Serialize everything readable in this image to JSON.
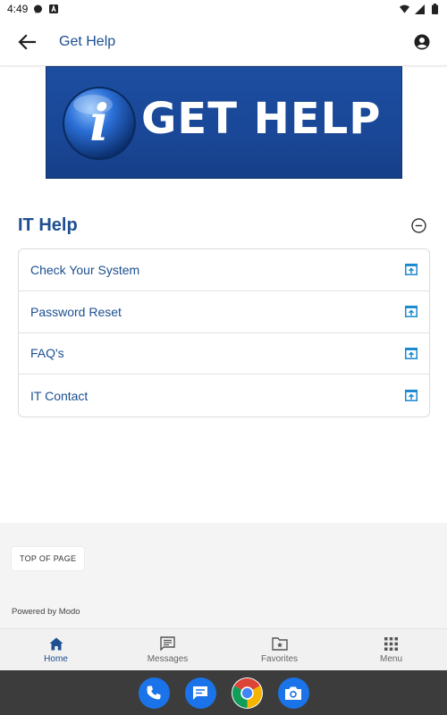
{
  "status_bar": {
    "time": "4:49"
  },
  "header": {
    "title": "Get Help",
    "back_icon": "arrow-left-icon",
    "account_icon": "account-circle-icon"
  },
  "banner": {
    "text": "GET HELP",
    "logo_letter": "i"
  },
  "section": {
    "title": "IT Help",
    "collapse_icon": "minus-circle-icon",
    "items": [
      {
        "label": "Check Your System",
        "icon": "open-external-icon"
      },
      {
        "label": "Password Reset",
        "icon": "open-external-icon"
      },
      {
        "label": "FAQ's",
        "icon": "open-external-icon"
      },
      {
        "label": "IT Contact",
        "icon": "open-external-icon"
      }
    ]
  },
  "footer": {
    "top_button": "TOP OF PAGE",
    "powered_by": "Powered by Modo"
  },
  "tabs": [
    {
      "label": "Home",
      "icon": "home-icon",
      "active": true
    },
    {
      "label": "Messages",
      "icon": "messages-icon",
      "active": false
    },
    {
      "label": "Favorites",
      "icon": "favorites-folder-icon",
      "active": false
    },
    {
      "label": "Menu",
      "icon": "grid-menu-icon",
      "active": false
    }
  ],
  "dock": [
    {
      "name": "Phone",
      "icon": "phone-icon"
    },
    {
      "name": "Messages",
      "icon": "chat-icon"
    },
    {
      "name": "Chrome",
      "icon": "chrome-icon"
    },
    {
      "name": "Camera",
      "icon": "camera-icon"
    }
  ],
  "colors": {
    "brand": "#1d4f91",
    "accent": "#1a8ad0",
    "banner_bg": "#1a4797",
    "footer_bg": "#f4f4f4",
    "dock_bg": "#3c3c3c"
  }
}
